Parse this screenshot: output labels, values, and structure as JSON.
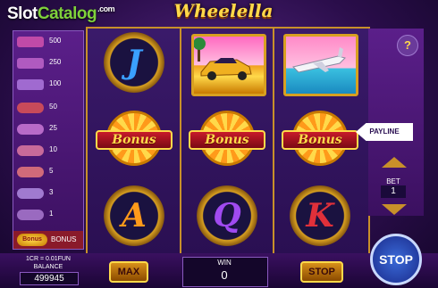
{
  "watermark": {
    "slot": "Slot",
    "catalog": "Catalog",
    "com": ".com"
  },
  "title": "Wheelella",
  "paytable": [
    {
      "value": "500",
      "color": "#c04aa8"
    },
    {
      "value": "250",
      "color": "#b05ac0"
    },
    {
      "value": "100",
      "color": "#a06ad0"
    },
    {
      "value": "50",
      "color": "#c84a5a"
    },
    {
      "value": "25",
      "color": "#b86ac8"
    },
    {
      "value": "10",
      "color": "#c86a9a"
    },
    {
      "value": "5",
      "color": "#d06a7a"
    },
    {
      "value": "3",
      "color": "#a07ad0"
    },
    {
      "value": "1",
      "color": "#9a6ac0"
    }
  ],
  "paytable_bonus": {
    "icon": "Bonus",
    "label": "BONUS"
  },
  "reels": {
    "top": [
      {
        "kind": "letter",
        "text": "J",
        "color": "#3aa0ff"
      },
      {
        "kind": "image",
        "name": "car"
      },
      {
        "kind": "image",
        "name": "jet"
      }
    ],
    "middle_label": "Bonus",
    "bottom": [
      {
        "kind": "letter",
        "text": "A",
        "color": "#ff9a1a"
      },
      {
        "kind": "letter",
        "text": "Q",
        "color": "#a04af0"
      },
      {
        "kind": "letter",
        "text": "K",
        "color": "#e0303a"
      }
    ]
  },
  "help": "?",
  "payline_label": "PAYLINE",
  "bet": {
    "label": "BET",
    "value": "1"
  },
  "credit_info": "1CR = 0.01FUN",
  "balance": {
    "label": "BALANCE",
    "value": "499945"
  },
  "max_label": "MAX",
  "win": {
    "label": "WIN",
    "value": "0"
  },
  "stop_small_label": "STOP",
  "stop_big_label": "STOP"
}
